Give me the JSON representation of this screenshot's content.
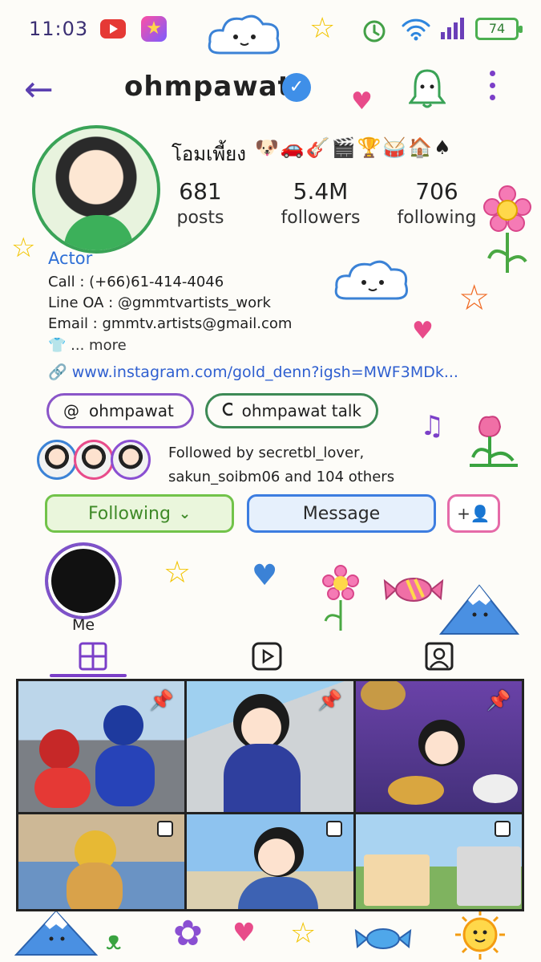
{
  "status_bar": {
    "time": "11:03",
    "battery": "74"
  },
  "header": {
    "username": "ohmpawat"
  },
  "profile": {
    "display_name": "โอมเพี้ยง",
    "emoji": "🐶🚗🎸🎬🏆🥁🏠♠",
    "stats": [
      {
        "value": "681",
        "label": "posts"
      },
      {
        "value": "5.4M",
        "label": "followers"
      },
      {
        "value": "706",
        "label": "following"
      }
    ],
    "category": "Actor",
    "bio_lines": [
      "Call : (+66)61-414-4046",
      "Line OA : @gmmtvartists_work",
      "Email : gmmtv.artists@gmail.com"
    ],
    "bio_more": "... more",
    "link": "www.instagram.com/gold_denn?igsh=MWF3MDk...",
    "threads_chip": "ohmpawat",
    "search_chip": "ohmpawat talk",
    "followed_by": "Followed by secretbl_lover, sakun_soibm06 and 104 others"
  },
  "actions": {
    "following": "Following",
    "message": "Message"
  },
  "highlight": {
    "label": "Me"
  },
  "colors": {
    "accent": "#7b3fc8",
    "verified": "#3f8fe8",
    "link": "#2f5fd0"
  }
}
